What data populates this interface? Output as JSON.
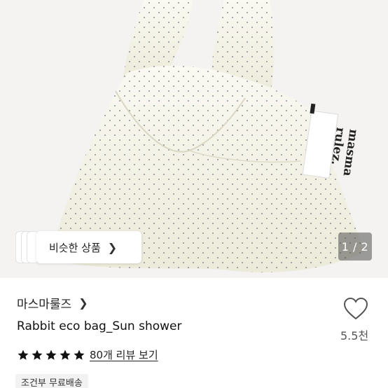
{
  "hero": {
    "brand_tag_line1": "masma",
    "brand_tag_line2": "rulez.",
    "similar_button_label": "비슷한 상품",
    "pager_text": "1 / 2"
  },
  "product": {
    "store_name": "마스마룰즈",
    "title": "Rabbit eco bag_Sun shower",
    "like_count": "5.5천",
    "rating": 5,
    "review_link_text": "80개 리뷰 보기",
    "shipping_badge": "조건부 무료배송"
  },
  "icons": {
    "chevron": "chevron-right-icon",
    "like": "heart-outline-icon",
    "star": "star-filled-icon"
  },
  "colors": {
    "star": "#111111",
    "pager_bg": "#505050",
    "bag": "#f7f5ec"
  }
}
